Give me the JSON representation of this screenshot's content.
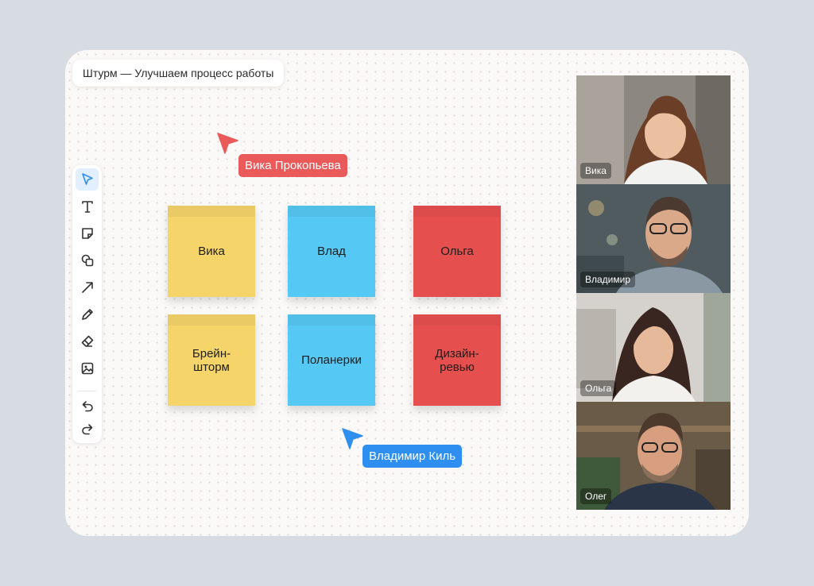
{
  "board": {
    "title": "Штурм — Улучшаем процесс работы"
  },
  "toolbar": {
    "tools": [
      {
        "icon": "cursor-arrow-icon",
        "active": true
      },
      {
        "icon": "text-icon"
      },
      {
        "icon": "sticky-note-icon"
      },
      {
        "icon": "shapes-icon"
      },
      {
        "icon": "arrow-icon"
      },
      {
        "icon": "pencil-icon"
      },
      {
        "icon": "eraser-icon"
      },
      {
        "icon": "image-icon"
      },
      {
        "icon": "undo-icon"
      },
      {
        "icon": "redo-icon"
      }
    ]
  },
  "stickies": [
    {
      "text": "Вика",
      "color": "#f5d46a"
    },
    {
      "text": "Влад",
      "color": "#55c8f3"
    },
    {
      "text": "Ольга",
      "color": "#e5504f"
    },
    {
      "text": "Брейн-\nшторм",
      "color": "#f5d46a"
    },
    {
      "text": "Поланерки",
      "color": "#55c8f3"
    },
    {
      "text": "Дизайн-\nревью",
      "color": "#e5504f"
    }
  ],
  "cursors": [
    {
      "name": "Вика Прокопьева",
      "color": "#eb5a5a"
    },
    {
      "name": "Владимир Киль",
      "color": "#2f8ff0"
    }
  ],
  "participants": [
    {
      "name": "Вика",
      "active": true
    },
    {
      "name": "Владимир"
    },
    {
      "name": "Ольга"
    },
    {
      "name": "Олег"
    }
  ]
}
